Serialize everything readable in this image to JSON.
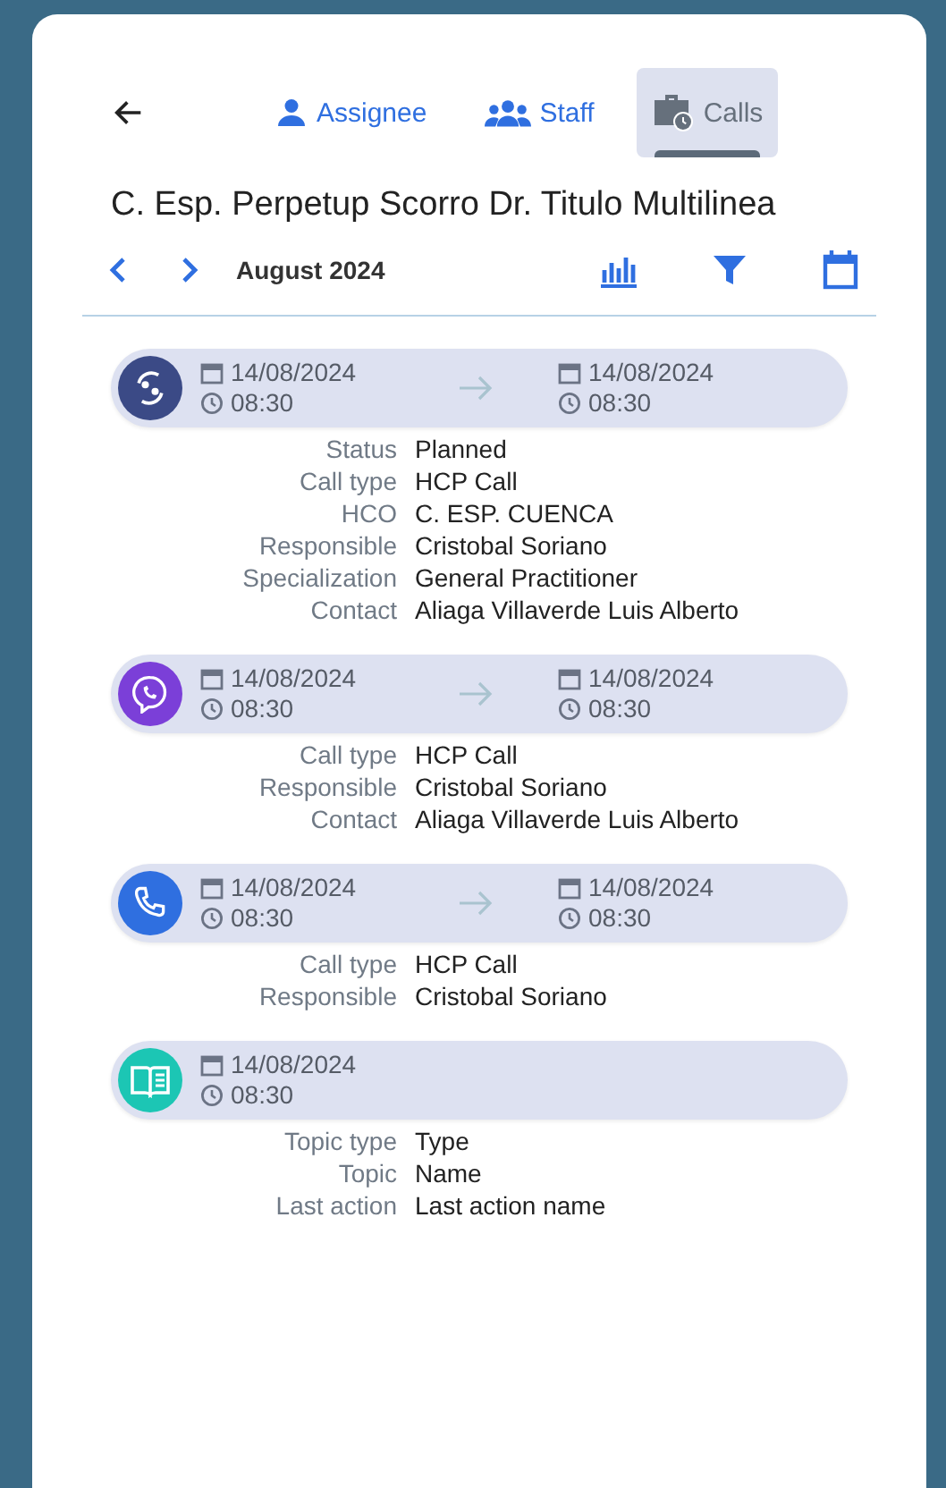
{
  "tabs": [
    {
      "label": "Assignee",
      "kind": "person",
      "selected": false
    },
    {
      "label": "Staff",
      "kind": "group",
      "selected": false
    },
    {
      "label": "Calls",
      "kind": "briefcase",
      "selected": true
    }
  ],
  "title": "C. Esp. Perpetup Scorro Dr. Titulo Multilinea",
  "month": "August 2024",
  "items": [
    {
      "kind": "meeting",
      "color": "#3b4a86",
      "start": {
        "date": "14/08/2024",
        "time": "08:30"
      },
      "end": {
        "date": "14/08/2024",
        "time": "08:30"
      },
      "details": [
        {
          "label": "Status",
          "value": "Planned"
        },
        {
          "label": "Call type",
          "value": "HCP Call"
        },
        {
          "label": "HCO",
          "value": "C. ESP. CUENCA"
        },
        {
          "label": "Responsible",
          "value": "Cristobal Soriano"
        },
        {
          "label": "Specialization",
          "value": "General Practitioner"
        },
        {
          "label": "Contact",
          "value": "Aliaga Villaverde Luis Alberto"
        }
      ]
    },
    {
      "kind": "chat",
      "color": "#7b3fd8",
      "start": {
        "date": "14/08/2024",
        "time": "08:30"
      },
      "end": {
        "date": "14/08/2024",
        "time": "08:30"
      },
      "details": [
        {
          "label": "Call type",
          "value": "HCP Call"
        },
        {
          "label": "Responsible",
          "value": "Cristobal Soriano"
        },
        {
          "label": "Contact",
          "value": "Aliaga Villaverde Luis Alberto"
        }
      ]
    },
    {
      "kind": "phone",
      "color": "#2f6fe0",
      "start": {
        "date": "14/08/2024",
        "time": "08:30"
      },
      "end": {
        "date": "14/08/2024",
        "time": "08:30"
      },
      "details": [
        {
          "label": "Call type",
          "value": "HCP Call"
        },
        {
          "label": "Responsible",
          "value": "Cristobal Soriano"
        }
      ]
    },
    {
      "kind": "book",
      "color": "#1cc6b4",
      "start": {
        "date": "14/08/2024",
        "time": "08:30"
      },
      "details": [
        {
          "label": "Topic type",
          "value": "Type"
        },
        {
          "label": "Topic",
          "value": "Name"
        },
        {
          "label": "Last action",
          "value": "Last action name"
        }
      ]
    }
  ]
}
